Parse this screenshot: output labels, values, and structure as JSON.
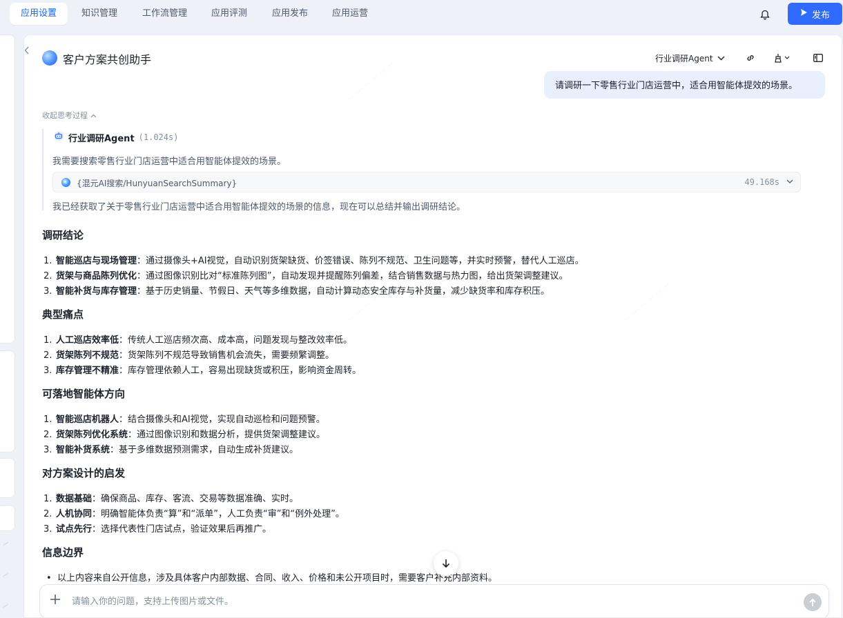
{
  "nav": {
    "tabs": [
      {
        "label": "应用设置"
      },
      {
        "label": "知识管理"
      },
      {
        "label": "工作流管理"
      },
      {
        "label": "应用评测"
      },
      {
        "label": "应用发布"
      },
      {
        "label": "应用运营"
      }
    ],
    "active_tab": "应用设置",
    "publish_label": "发布"
  },
  "header": {
    "app_title": "客户方案共创助手",
    "agent_select": "行业调研Agent"
  },
  "chat": {
    "user_message": "请调研一下零售行业门店运营中，适合用智能体提效的场景。",
    "thinking_toggle": "收起思考过程",
    "agent_name": "行业调研Agent",
    "agent_time": "(1.024s)",
    "think_line1": "我需要搜索零售行业门店运营中适合用智能体提效的场景。",
    "tool_name": "{混元AI搜索/HunyuanSearchSummary}",
    "tool_time": "49.168s",
    "think_line2": "我已经获取了关于零售行业门店运营中适合用智能体提效的场景的信息，现在可以总结并输出调研结论。"
  },
  "sections": [
    {
      "title": "调研结论",
      "items": [
        {
          "bold": "智能巡店与现场管理",
          "text": "：通过摄像头+AI视觉，自动识别货架缺货、价签错误、陈列不规范、卫生问题等，并实时预警，替代人工巡店。"
        },
        {
          "bold": "货架与商品陈列优化",
          "text": "：通过图像识别比对“标准陈列图”，自动发现并提醒陈列偏差，结合销售数据与热力图，给出货架调整建议。"
        },
        {
          "bold": "智能补货与库存管理",
          "text": "：基于历史销量、节假日、天气等多维数据，自动计算动态安全库存与补货量，减少缺货率和库存积压。"
        }
      ]
    },
    {
      "title": "典型痛点",
      "items": [
        {
          "bold": "人工巡店效率低",
          "text": "：传统人工巡店频次高、成本高，问题发现与整改效率低。"
        },
        {
          "bold": "货架陈列不规范",
          "text": "：货架陈列不规范导致销售机会流失，需要频繁调整。"
        },
        {
          "bold": "库存管理不精准",
          "text": "：库存管理依赖人工，容易出现缺货或积压，影响资金周转。"
        }
      ]
    },
    {
      "title": "可落地智能体方向",
      "items": [
        {
          "bold": "智能巡店机器人",
          "text": "：结合摄像头和AI视觉，实现自动巡检和问题预警。"
        },
        {
          "bold": "货架陈列优化系统",
          "text": "：通过图像识别和数据分析，提供货架调整建议。"
        },
        {
          "bold": "智能补货系统",
          "text": "：基于多维数据预测需求，自动生成补货建议。"
        }
      ]
    },
    {
      "title": "对方案设计的启发",
      "items": [
        {
          "bold": "数据基础",
          "text": "：确保商品、库存、客流、交易等数据准确、实时。"
        },
        {
          "bold": "人机协同",
          "text": "：明确智能体负责“算”和“派单”，人工负责“审”和“例外处理”。"
        },
        {
          "bold": "试点先行",
          "text": "：选择代表性门店试点，验证效果后再推广。"
        }
      ]
    },
    {
      "title": "信息边界",
      "bullet": "以上内容来自公开信息，涉及具体客户内部数据、合同、收入、价格和未公开项目时，需要客户补充内部资料。"
    }
  ],
  "input": {
    "placeholder": "请输入你的问题，支持上传图片或文件。"
  },
  "colors": {
    "accent": "#2f6bff",
    "active_tab_text": "#1664ff",
    "user_bubble": "#e8effd",
    "background": "#eef1f8"
  }
}
